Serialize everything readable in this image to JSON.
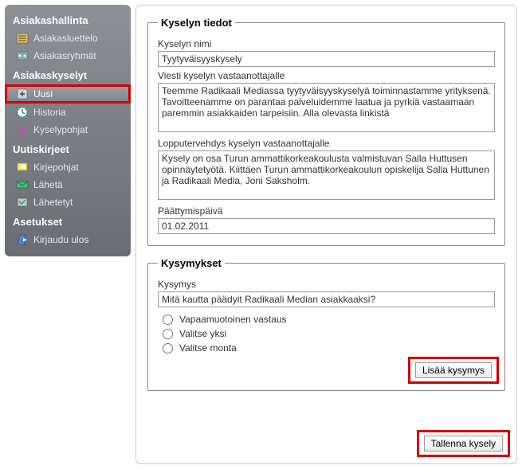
{
  "sidebar": {
    "sections": [
      {
        "title": "Asiakashallinta",
        "items": [
          {
            "label": "Asiakasluettelo",
            "icon": "customer-list-icon"
          },
          {
            "label": "Asiakasryhmät",
            "icon": "customer-groups-icon"
          }
        ]
      },
      {
        "title": "Asiakaskyselyt",
        "items": [
          {
            "label": "Uusi",
            "icon": "new-icon",
            "highlighted": true
          },
          {
            "label": "Historia",
            "icon": "history-icon"
          },
          {
            "label": "Kyselypohjat",
            "icon": "templates-icon"
          }
        ]
      },
      {
        "title": "Uutiskirjeet",
        "items": [
          {
            "label": "Kirjepohjat",
            "icon": "letter-templates-icon"
          },
          {
            "label": "Lähetä",
            "icon": "send-icon"
          },
          {
            "label": "Lähetetyt",
            "icon": "sent-icon"
          }
        ]
      },
      {
        "title": "Asetukset",
        "items": [
          {
            "label": "Kirjaudu ulos",
            "icon": "logout-icon"
          }
        ]
      }
    ]
  },
  "survey": {
    "fieldset_title": "Kyselyn tiedot",
    "name_label": "Kyselyn nimi",
    "name_value": "Tyytyväisyyskysely",
    "message_label": "Viesti kyselyn vastaanottajalle",
    "message_value": "Teemme Radikaali Mediassa tyytyväisyyskyselyä toiminnastamme yrityksenä. Tavoitteenamme on parantaa palveluidemme laatua ja pyrkiä vastaamaan paremmin asiakkaiden tarpeisiin. Alla olevasta linkistä",
    "ending_label": "Lopputervehdys kyselyn vastaanottajalle",
    "ending_value": "Kysely on osa Turun ammattikorkeakoulusta valmistuvan Salla Huttusen opinnäytetyötä. Kiittäen Turun ammattikorkeakoulun opiskelija Salla Huttunen ja Radikaali Media, Joni Saksholm.",
    "end_date_label": "Päättymispäivä",
    "end_date_value": "01.02.2011"
  },
  "questions": {
    "fieldset_title": "Kysymykset",
    "question_label": "Kysymys",
    "question_value": "Mitä kautta päädyit Radikaali Median asiakkaaksi?",
    "option_freeform": "Vapaamuotoinen vastaus",
    "option_single": "Valitse yksi",
    "option_multi": "Valitse monta",
    "add_button": "Lisää kysymys"
  },
  "save_button": "Tallenna kysely"
}
